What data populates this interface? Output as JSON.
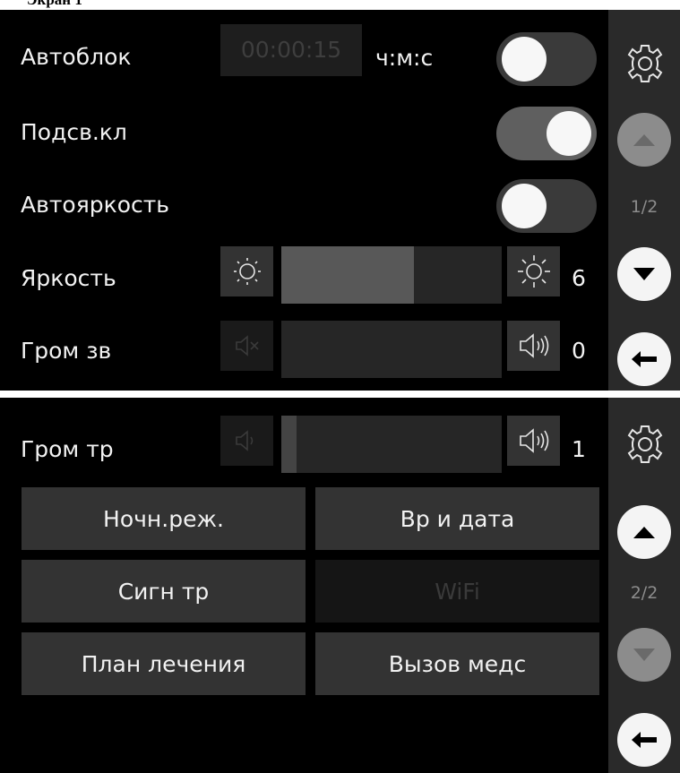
{
  "header": {
    "text": "Экран 1"
  },
  "page1": {
    "pager": "1/2",
    "autolock": {
      "label": "Автоблок",
      "time": "00:00:15",
      "unit": "ч:м:с",
      "enabled": false
    },
    "backlight": {
      "label": "Подсв.кл",
      "enabled": true
    },
    "autobrightness": {
      "label": "Автояркость",
      "enabled": false
    },
    "brightness": {
      "label": "Яркость",
      "value": "6",
      "level_fraction": 0.6
    },
    "volume_sound": {
      "label": "Гром зв",
      "value": "0",
      "level_fraction": 0.0
    }
  },
  "page2": {
    "pager": "2/2",
    "volume_alarm": {
      "label": "Гром тр",
      "value": "1",
      "level_fraction": 0.07
    },
    "buttons": {
      "night_mode": "Ночн.реж.",
      "time_date": "Вр и дата",
      "alarm_signal": "Сигн тр",
      "wifi": "WiFi",
      "treatment_plan": "План лечения",
      "call_nurse": "Вызов медс"
    }
  },
  "icons": {
    "settings": "gear-icon",
    "up": "arrow-up-icon",
    "down": "arrow-down-icon",
    "back": "arrow-left-icon",
    "brightness_down": "sun-small-icon",
    "brightness_up": "sun-large-icon",
    "mute": "speaker-mute-icon",
    "volume_down": "speaker-low-icon",
    "volume_up": "speaker-loud-icon"
  },
  "colors": {
    "background": "#000000",
    "button": "#333333",
    "accent_knob": "#f7f7f7"
  }
}
